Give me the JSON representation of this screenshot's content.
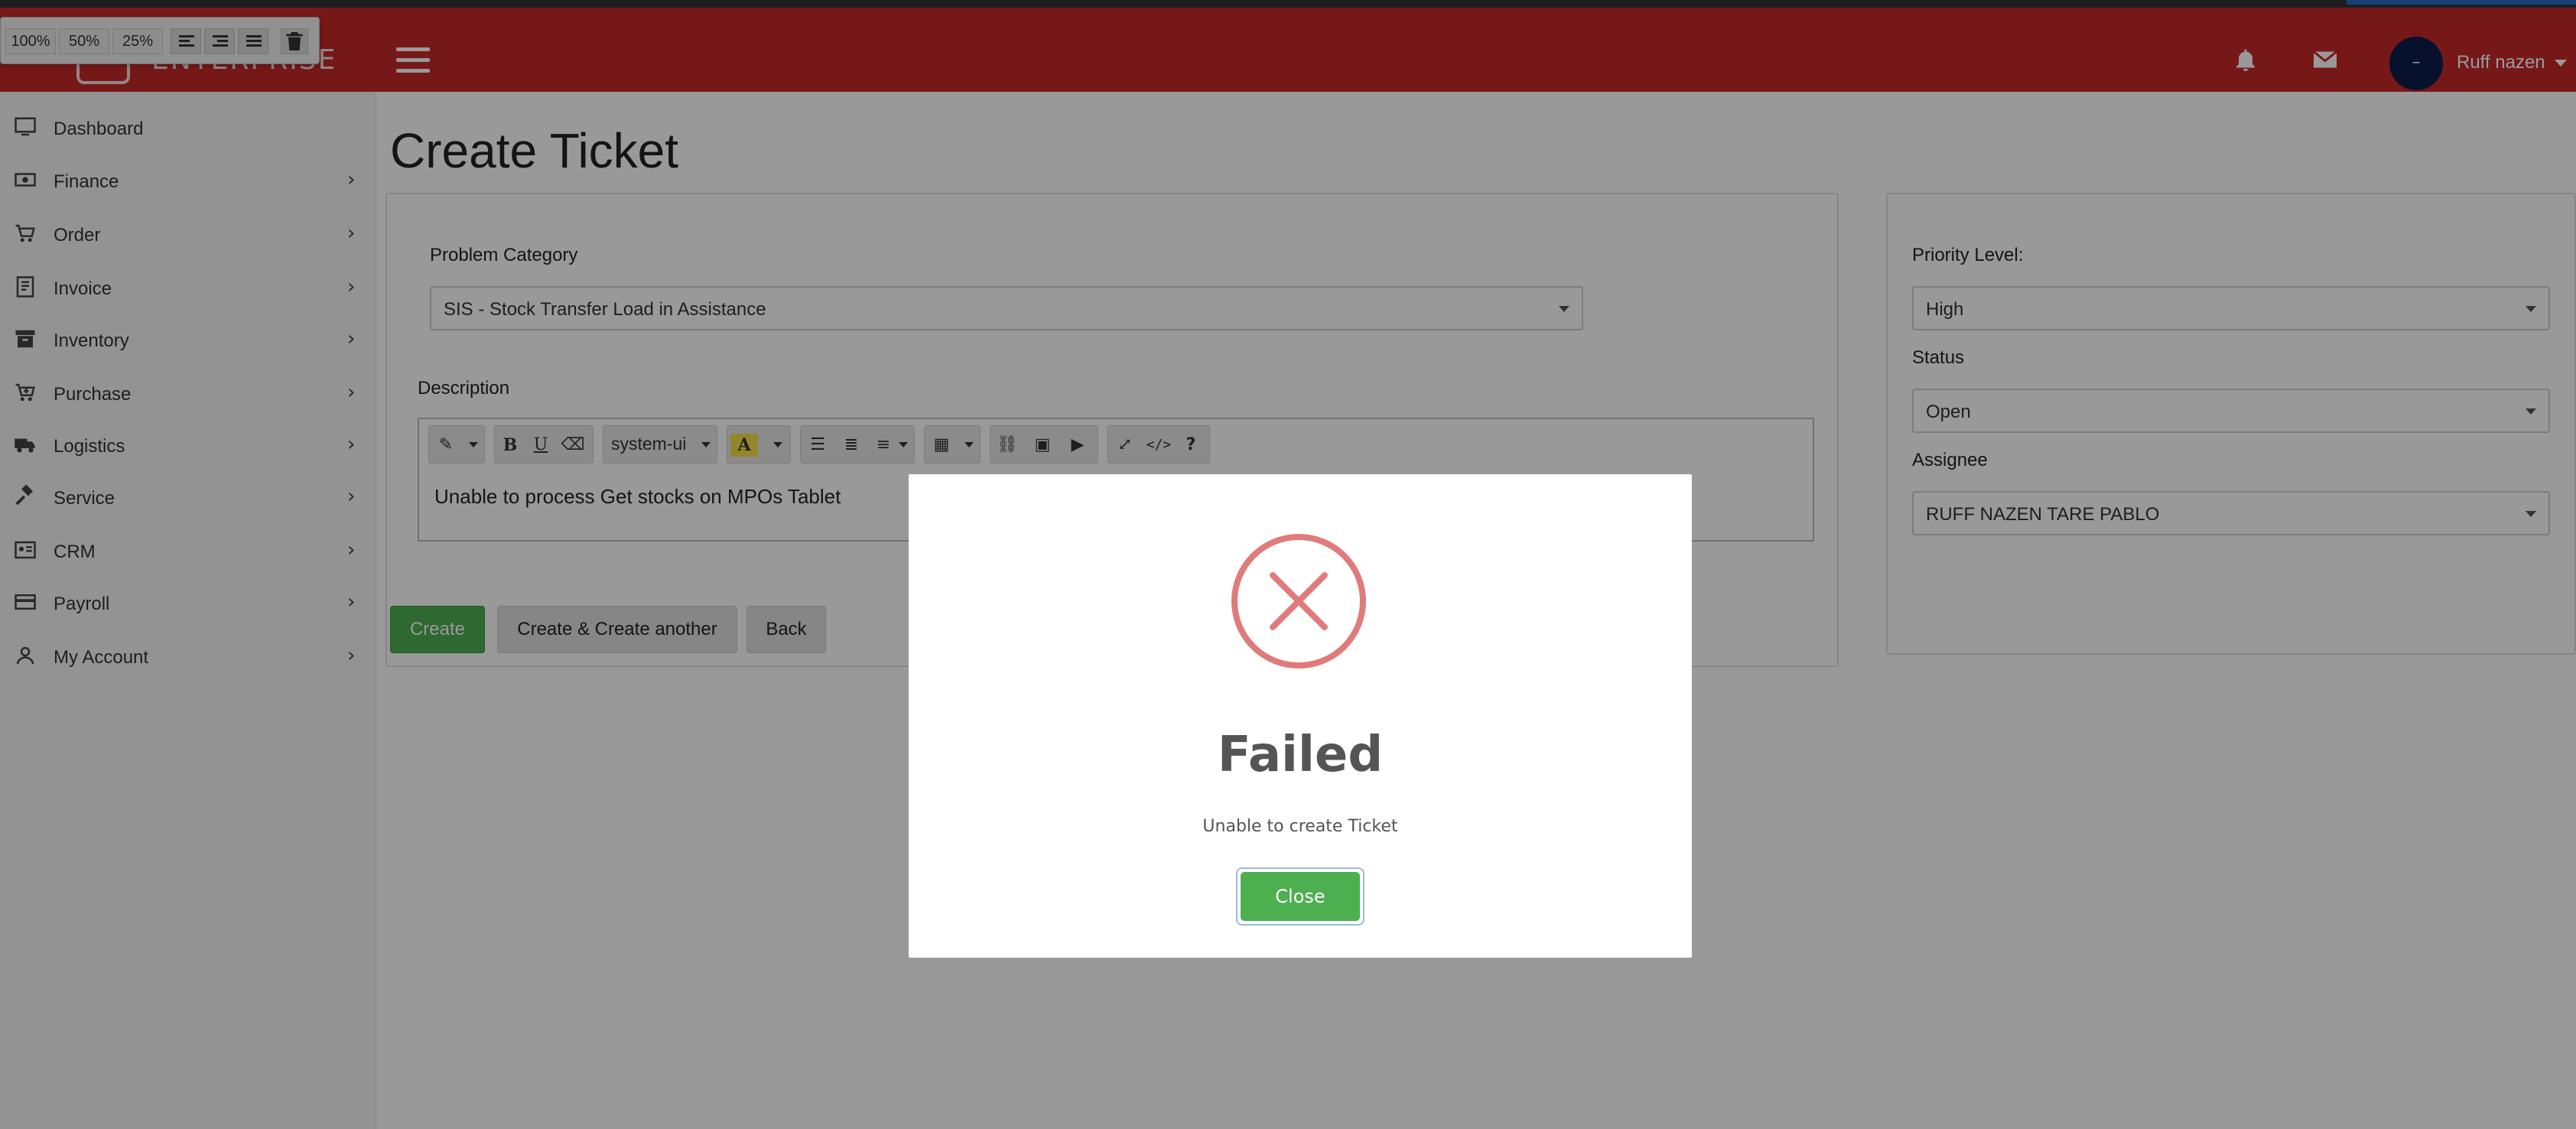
{
  "header": {
    "brand": "ENTERPRISE",
    "user_name": "Ruff nazen",
    "avatar_initial": "–",
    "bell_icon": "bell-icon",
    "mail_icon": "envelope-icon",
    "color": "#c62828"
  },
  "zoom_toolbar": {
    "z100": "100%",
    "z50": "50%",
    "z25": "25%"
  },
  "sidebar": {
    "items": [
      {
        "label": "Dashboard",
        "icon": "monitor-icon",
        "chevron": ""
      },
      {
        "label": "Finance",
        "icon": "money-icon",
        "chevron": "›"
      },
      {
        "label": "Order",
        "icon": "cart-icon",
        "chevron": "›"
      },
      {
        "label": "Invoice",
        "icon": "receipt-icon",
        "chevron": "›"
      },
      {
        "label": "Inventory",
        "icon": "archive-icon",
        "chevron": "›"
      },
      {
        "label": "Purchase",
        "icon": "cart-plus-icon",
        "chevron": "›"
      },
      {
        "label": "Logistics",
        "icon": "truck-icon",
        "chevron": "›"
      },
      {
        "label": "Service",
        "icon": "gavel-icon",
        "chevron": "›"
      },
      {
        "label": "CRM",
        "icon": "id-card-icon",
        "chevron": "›"
      },
      {
        "label": "Payroll",
        "icon": "credit-card-icon",
        "chevron": "›"
      },
      {
        "label": "My Account",
        "icon": "user-icon",
        "chevron": "›"
      }
    ]
  },
  "main": {
    "title": "Create Ticket",
    "problem_category_label": "Problem Category",
    "problem_category_value": "SIS - Stock Transfer Load in Assistance",
    "description_label": "Description",
    "editor": {
      "font": "system-ui",
      "text": "Unable to process Get stocks on MPOs Tablet"
    },
    "priority_label": "Priority Level:",
    "priority_value": "High",
    "status_label": "Status",
    "status_value": "Open",
    "assignee_label": "Assignee",
    "assignee_value": "RUFF NAZEN TARE PABLO",
    "buttons": {
      "create": "Create",
      "create_another": "Create & Create another",
      "back": "Back"
    }
  },
  "modal": {
    "title": "Failed",
    "message": "Unable to create Ticket",
    "close": "Close",
    "icon": "error-x-icon",
    "icon_color": "#e07b7b",
    "button_color": "#4caf50"
  }
}
